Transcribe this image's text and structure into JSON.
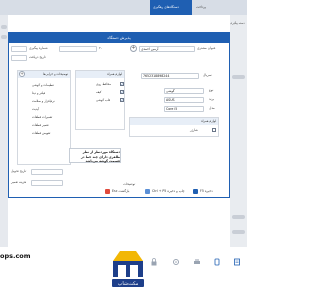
{
  "app": {
    "top_tabs": [
      "دستگاه‌های رهگیری",
      "پرداخت"
    ],
    "breadcrumb": "پذیرش دستگاه",
    "side_menu_label": "دسته پیگیری"
  },
  "dialog": {
    "title": "پذیرش دستگاه",
    "customer_label": "عنوان مشتری",
    "customer_value": "آرمین احمدی",
    "customer_id": "۲۰",
    "tracking_label": "شماره پیگیری",
    "date_label": "تاریخ دریافت",
    "serial_label": "سریال",
    "serial_value": "7652318898244",
    "warranty_label": "گارانتی",
    "type_label": "نوع",
    "type_value": "گوشی",
    "brand_label": "برند",
    "brand_value": "ASUS",
    "model_label": "مدل",
    "model_value": "Core i5",
    "extra_label": "لوازم همراه",
    "extra_item": "شارژر",
    "accessories_header": "لوازم همراه",
    "accessories": [
      {
        "label": "محافظ روی",
        "checked": true
      },
      {
        "label": "کیف",
        "checked": true
      },
      {
        "label": "قاب گوشی",
        "checked": true
      }
    ],
    "problems_header": "توضیحات و خرابی‌ها",
    "problems": [
      "تنظیمات و گوشی",
      "فیلتر و دیتا",
      "نرم‌افزار و سلامت",
      "آپدیت",
      "تعمیرات قطعات",
      "تعمیر قطعات",
      "تعویض قطعات"
    ],
    "delivery_label": "تاریخ تحویل",
    "cost_label": "هزینه تعمیر",
    "note_label": "توضیحات",
    "note_text": "دستگاه موردنظر از نظر ظاهری دارای چند خط در قسمت گوشه می‌باشد",
    "buttons": {
      "return": "Esc بازگشت",
      "print_save": "Ctrl + P5 چاپ و ذخیره",
      "save": "F5 ذخیره"
    }
  },
  "bottom": {
    "site_text": "ops.com",
    "logo_text": "مکث‌شاپ",
    "icons": [
      "lock-icon",
      "settings-icon",
      "printer-icon",
      "device-icon",
      "document-icon"
    ]
  },
  "colors": {
    "accent": "#1f5fb2",
    "chrome": "#d7dde6",
    "logo_blue": "#1e3f8a",
    "logo_yellow": "#f2b705"
  }
}
